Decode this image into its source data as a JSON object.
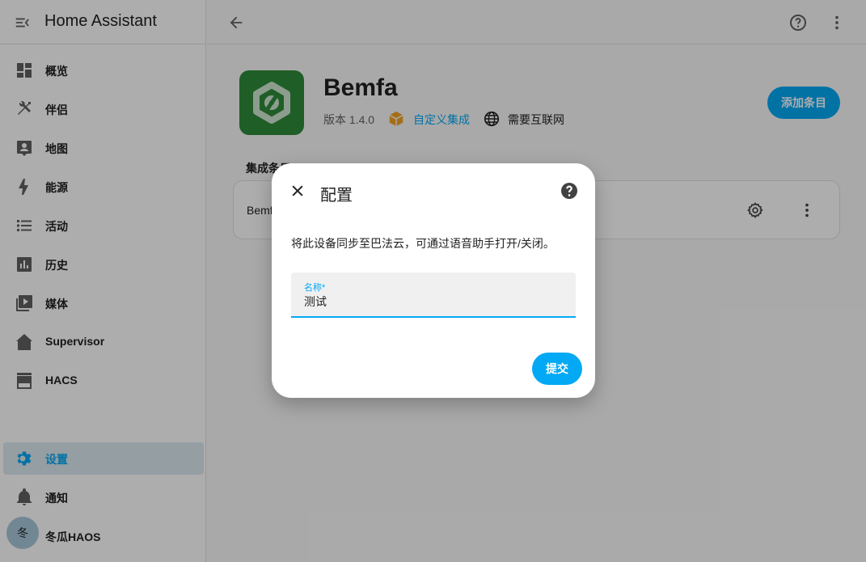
{
  "app": {
    "title": "Home Assistant"
  },
  "sidebar": {
    "items": [
      {
        "label": "概览",
        "icon": "dashboard-icon"
      },
      {
        "label": "伴侣",
        "icon": "tools-icon"
      },
      {
        "label": "地图",
        "icon": "map-account-icon"
      },
      {
        "label": "能源",
        "icon": "lightning-bolt-icon"
      },
      {
        "label": "活动",
        "icon": "format-list-icon"
      },
      {
        "label": "历史",
        "icon": "chart-box-icon"
      },
      {
        "label": "媒体",
        "icon": "play-box-multiple-icon"
      },
      {
        "label": "Supervisor",
        "icon": "home-assistant-icon"
      },
      {
        "label": "HACS",
        "icon": "hacs-store-icon"
      }
    ],
    "settings": {
      "label": "设置",
      "icon": "gear-icon",
      "active": true
    },
    "notifications": {
      "label": "通知",
      "icon": "bell-icon"
    },
    "user": {
      "avatar_letter": "冬",
      "name": "冬瓜HAOS"
    }
  },
  "integration": {
    "name": "Bemfa",
    "version": "版本 1.4.0",
    "custom_label": "自定义集成",
    "internet_label": "需要互联网",
    "add_entry_label": "添加条目",
    "entries_header": "集成条目",
    "entry_name": "Bemfa"
  },
  "dialog": {
    "title": "配置",
    "description": "将此设备同步至巴法云，可通过语音助手打开/关闭。",
    "field_label": "名称*",
    "field_value": "测试",
    "submit_label": "提交"
  },
  "colors": {
    "accent": "#03a9f4",
    "logo_bg": "#2e8b3a",
    "custom_badge": "#f4a425"
  }
}
